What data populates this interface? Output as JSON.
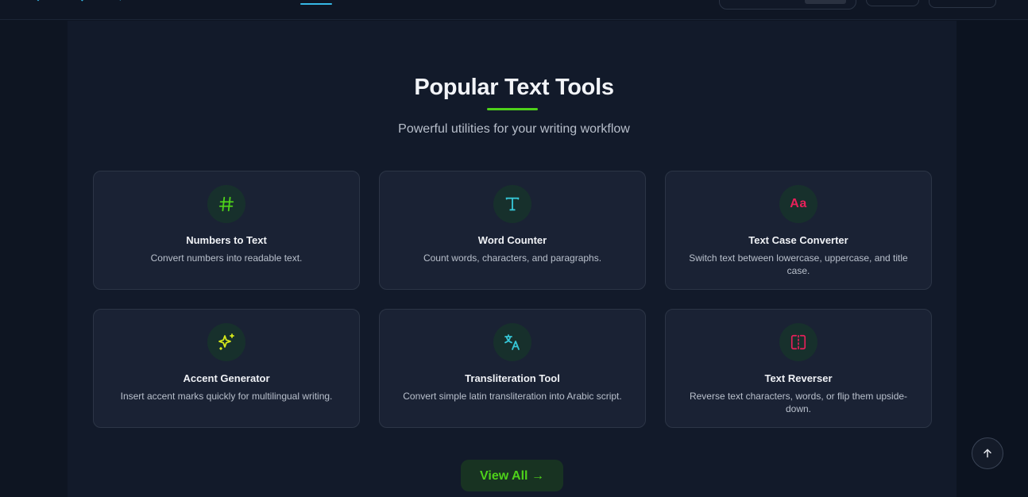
{
  "colors": {
    "accent_green": "#4ed11a",
    "accent_cyan": "#36c6d6",
    "accent_pink": "#e8205a",
    "accent_yellow": "#d6e81a"
  },
  "section": {
    "title": "Popular Text Tools",
    "subtitle": "Powerful utilities for your writing workflow"
  },
  "tools": [
    {
      "title": "Numbers to Text",
      "desc": "Convert numbers into readable text.",
      "icon": "hash-icon"
    },
    {
      "title": "Word Counter",
      "desc": "Count words, characters, and paragraphs.",
      "icon": "letter-t-icon"
    },
    {
      "title": "Text Case Converter",
      "desc": "Switch text between lowercase, uppercase, and title case.",
      "icon": "text-case-icon",
      "icon_text": "Aa"
    },
    {
      "title": "Accent Generator",
      "desc": "Insert accent marks quickly for multilingual writing.",
      "icon": "sparkles-icon"
    },
    {
      "title": "Transliteration Tool",
      "desc": "Convert simple latin transliteration into Arabic script.",
      "icon": "translate-icon"
    },
    {
      "title": "Text Reverser",
      "desc": "Reverse text characters, words, or flip them upside-down.",
      "icon": "flip-icon"
    }
  ],
  "view_all_label": "View All →",
  "scroll_top_icon": "arrow-up-icon"
}
